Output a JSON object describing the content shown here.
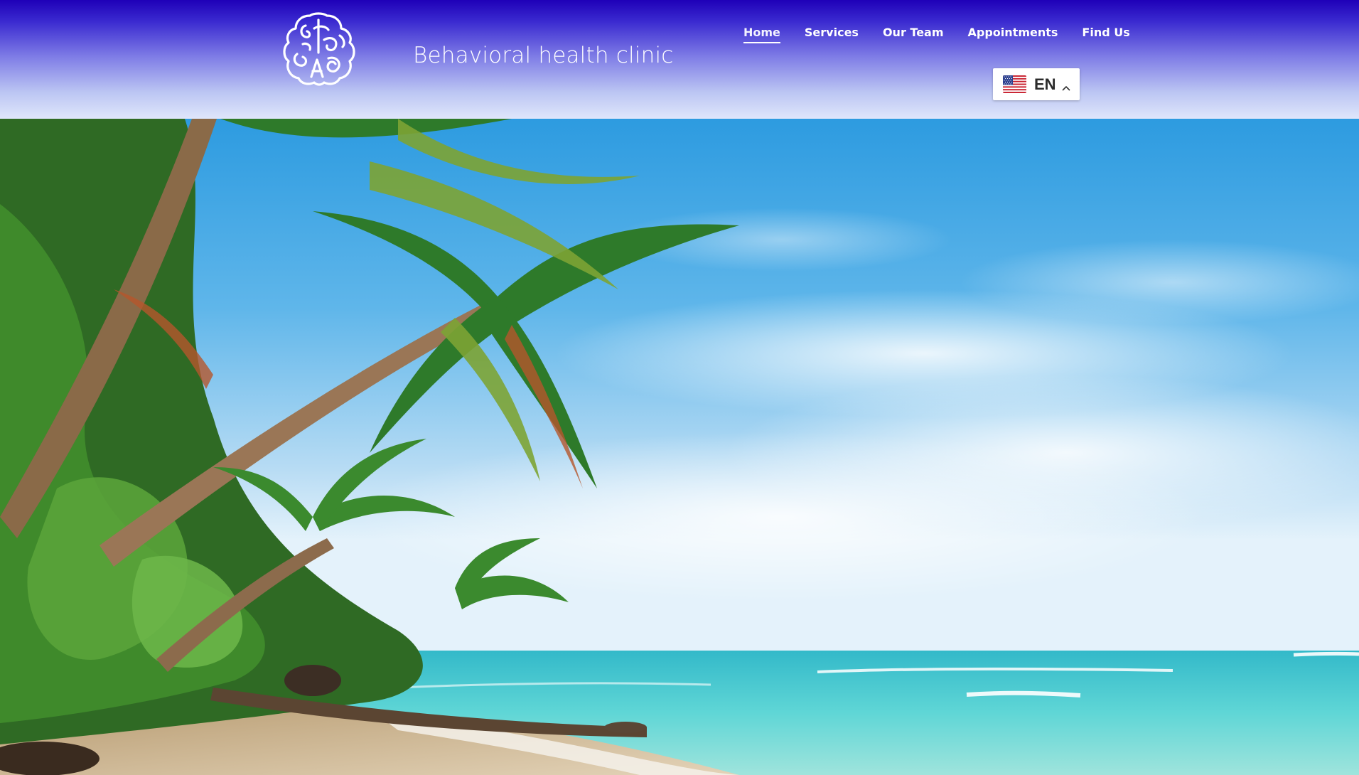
{
  "site": {
    "tagline": "Behavioral health clinic",
    "logo_text": "SCFAE"
  },
  "nav": {
    "items": [
      {
        "label": "Home",
        "active": true
      },
      {
        "label": "Services",
        "active": false
      },
      {
        "label": "Our Team",
        "active": false
      },
      {
        "label": "Appointments",
        "active": false
      },
      {
        "label": "Find Us",
        "active": false
      }
    ]
  },
  "language": {
    "code": "EN",
    "flag": "us-flag-icon",
    "caret": "chevron-up-icon"
  },
  "hero": {
    "image": "tropical-beach-palm-trees"
  },
  "colors": {
    "header_top": "#1f00b8",
    "header_bottom": "#dfe6fb",
    "text_white": "#ffffff"
  }
}
